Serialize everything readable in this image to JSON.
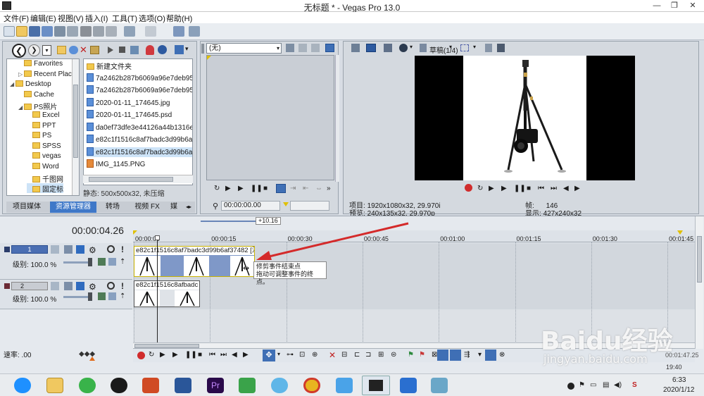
{
  "window": {
    "title": "无标题 * - Vegas Pro 13.0"
  },
  "menu": [
    "文件(F)",
    "编辑(E)",
    "视图(V)",
    "插入(I)",
    "工具(T)",
    "选项(O)",
    "帮助(H)"
  ],
  "explorer": {
    "tree": [
      {
        "label": "Favorites",
        "indent": 1
      },
      {
        "label": "Recent Places",
        "indent": 1
      },
      {
        "label": "Desktop",
        "indent": 0
      },
      {
        "label": "Cache",
        "indent": 1
      },
      {
        "label": "PS照片",
        "indent": 1
      },
      {
        "label": "Excel",
        "indent": 2
      },
      {
        "label": "PPT",
        "indent": 2
      },
      {
        "label": "PS",
        "indent": 2
      },
      {
        "label": "SPSS",
        "indent": 2
      },
      {
        "label": "vegas",
        "indent": 2
      },
      {
        "label": "Word",
        "indent": 2
      },
      {
        "label": "千图网",
        "indent": 2
      },
      {
        "label": "固定标",
        "indent": 2
      }
    ],
    "files": [
      "新建文件夹",
      "7a2462b287b6069a96e7deb95d",
      "7a2462b287b6069a96e7deb95d",
      "2020-01-11_174645.jpg",
      "2020-01-11_174645.psd",
      "da0ef73dfe3e44126a44b1316e5",
      "e82c1f1516c8af7badc3d99b6af3",
      "e82c1f1516c8af7badc3d99b6af3",
      "IMG_1145.PNG"
    ],
    "status": "静态: 500x500x32, 未压缩",
    "tabs": [
      "项目媒体",
      "资源管理器",
      "转场",
      "视频 FX",
      "媒"
    ]
  },
  "trimmer": {
    "dropdown": "(无)",
    "timecode": "00:00:00.00"
  },
  "preview": {
    "quality": "草稿(1/4)",
    "project_label": "项目:",
    "project_value": "1920x1080x32, 29.970i",
    "preview_label": "预览:",
    "preview_value": "240x135x32, 29.970p",
    "frame_label": "帧:",
    "frame_value": "146",
    "display_label": "显示:",
    "display_value": "427x240x32"
  },
  "timeline": {
    "timecode": "00:00:04.26",
    "zoom_badge": "+10.16",
    "ruler": [
      "00:00:00",
      "00:00:15",
      "00:00:30",
      "00:00:45",
      "00:01:00",
      "00:01:15",
      "00:01:30",
      "00:01:45"
    ],
    "tracks": [
      {
        "num": "1",
        "level": "级别: 100.0 %",
        "clip": "e82c1f1516c8af7badc3d99b6af37482 [混"
      },
      {
        "num": "2",
        "level": "级别: 100.0 %",
        "clip": "e82c1f1516c8afbadc"
      }
    ],
    "tooltip_line1": "修剪事件结束点",
    "tooltip_line2": "拖动可调整事件的终点。",
    "rate": "速率: .00",
    "end_time": "00:01:47.25",
    "status_time": "19:40"
  },
  "taskbar": {
    "time": "6:33",
    "date": "2020/1/12"
  },
  "watermark": {
    "brand": "Baidu经验",
    "url": "jingyan.baidu.com"
  }
}
